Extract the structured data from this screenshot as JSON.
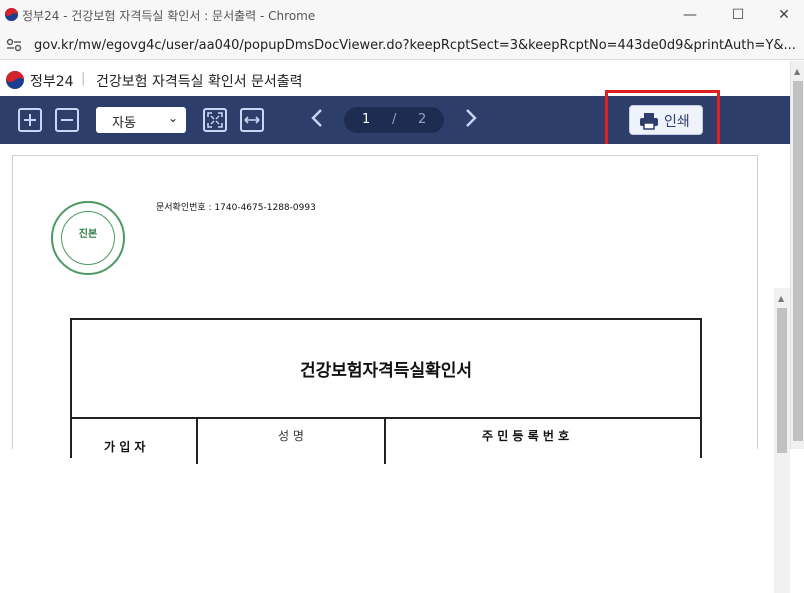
{
  "window": {
    "title": "정부24 - 건강보험 자격득실 확인서 : 문서출력 - Chrome",
    "minimize": "—",
    "maximize": "☐",
    "close": "✕"
  },
  "address": {
    "url": "gov.kr/mw/egovg4c/user/aa040/popupDmsDocViewer.do?keepRcptSect=3&keepRcptNo=443de0d9&printAuth=Y&..."
  },
  "header": {
    "brand": "정부24",
    "separator": "|",
    "doc_title": "건강보험 자격득실 확인서 문서출력"
  },
  "toolbar": {
    "zoom_value": "자동",
    "zoom_chevron": "⌄",
    "prev_icon": "chevron-left-icon",
    "next_icon": "chevron-right-icon",
    "page_current": "1",
    "page_separator": "/",
    "page_total": "2",
    "print_label": "인쇄",
    "accent": "#2e3e6b",
    "highlight_color": "#e02020"
  },
  "document": {
    "issue_number": "문서확인번호 : 1740-4675-1288-0993",
    "stamp_label": "진본",
    "heading": "건강보험자격득실확인서",
    "col_name": "성 명",
    "col_rrn": "주 민 등 록 번 호",
    "row_label": "가 입 자"
  }
}
